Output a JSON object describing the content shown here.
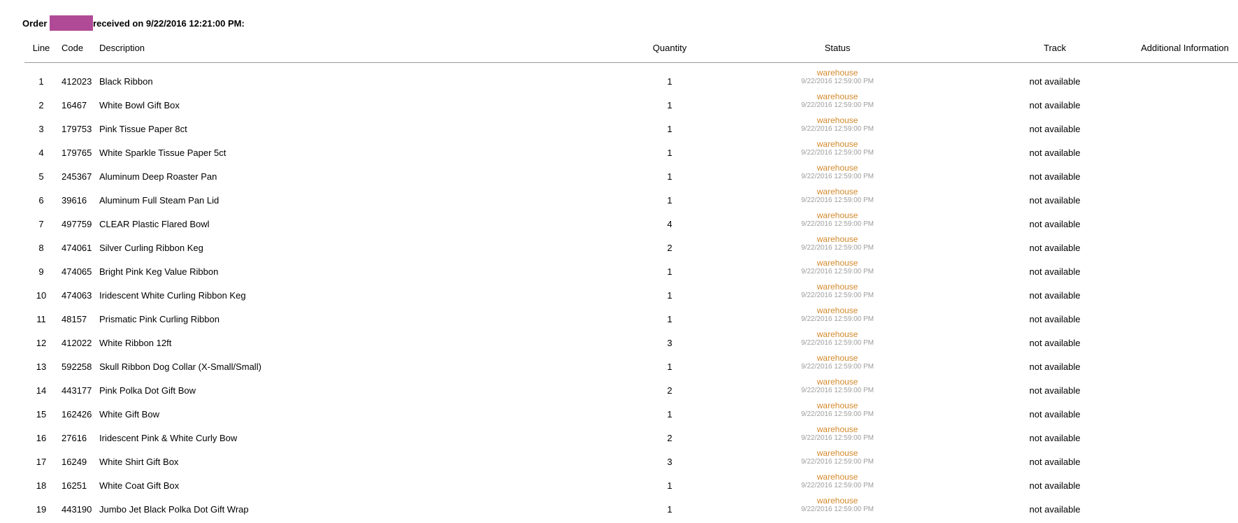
{
  "order": {
    "prefix": "Order",
    "suffix": "received on 9/22/2016 12:21:00 PM:",
    "redaction_color": "#b14a96"
  },
  "columns": {
    "line": "Line",
    "code": "Code",
    "description": "Description",
    "quantity": "Quantity",
    "status": "Status",
    "track": "Track",
    "additional_info": "Additional Information"
  },
  "colors": {
    "status_text": "#d4892b",
    "status_date": "#9d9d9d",
    "divider": "#9a9a9a"
  },
  "rows": [
    {
      "line": "1",
      "code": "412023",
      "description": "Black Ribbon",
      "quantity": "1",
      "status": "warehouse",
      "status_date": "9/22/2016 12:59:00 PM",
      "track": "not available",
      "info": ""
    },
    {
      "line": "2",
      "code": "16467",
      "description": "White Bowl Gift Box",
      "quantity": "1",
      "status": "warehouse",
      "status_date": "9/22/2016 12:59:00 PM",
      "track": "not available",
      "info": ""
    },
    {
      "line": "3",
      "code": "179753",
      "description": "Pink Tissue Paper 8ct",
      "quantity": "1",
      "status": "warehouse",
      "status_date": "9/22/2016 12:59:00 PM",
      "track": "not available",
      "info": ""
    },
    {
      "line": "4",
      "code": "179765",
      "description": "White Sparkle Tissue Paper 5ct",
      "quantity": "1",
      "status": "warehouse",
      "status_date": "9/22/2016 12:59:00 PM",
      "track": "not available",
      "info": ""
    },
    {
      "line": "5",
      "code": "245367",
      "description": "Aluminum Deep Roaster Pan",
      "quantity": "1",
      "status": "warehouse",
      "status_date": "9/22/2016 12:59:00 PM",
      "track": "not available",
      "info": ""
    },
    {
      "line": "6",
      "code": "39616",
      "description": "Aluminum Full Steam Pan Lid",
      "quantity": "1",
      "status": "warehouse",
      "status_date": "9/22/2016 12:59:00 PM",
      "track": "not available",
      "info": ""
    },
    {
      "line": "7",
      "code": "497759",
      "description": "CLEAR Plastic Flared Bowl",
      "quantity": "4",
      "status": "warehouse",
      "status_date": "9/22/2016 12:59:00 PM",
      "track": "not available",
      "info": ""
    },
    {
      "line": "8",
      "code": "474061",
      "description": "Silver Curling Ribbon Keg",
      "quantity": "2",
      "status": "warehouse",
      "status_date": "9/22/2016 12:59:00 PM",
      "track": "not available",
      "info": ""
    },
    {
      "line": "9",
      "code": "474065",
      "description": "Bright Pink Keg Value Ribbon",
      "quantity": "1",
      "status": "warehouse",
      "status_date": "9/22/2016 12:59:00 PM",
      "track": "not available",
      "info": ""
    },
    {
      "line": "10",
      "code": "474063",
      "description": "Iridescent White Curling Ribbon Keg",
      "quantity": "1",
      "status": "warehouse",
      "status_date": "9/22/2016 12:59:00 PM",
      "track": "not available",
      "info": ""
    },
    {
      "line": "11",
      "code": "48157",
      "description": "Prismatic Pink Curling Ribbon",
      "quantity": "1",
      "status": "warehouse",
      "status_date": "9/22/2016 12:59:00 PM",
      "track": "not available",
      "info": ""
    },
    {
      "line": "12",
      "code": "412022",
      "description": "White Ribbon 12ft",
      "quantity": "3",
      "status": "warehouse",
      "status_date": "9/22/2016 12:59:00 PM",
      "track": "not available",
      "info": ""
    },
    {
      "line": "13",
      "code": "592258",
      "description": "Skull Ribbon Dog Collar (X-Small/Small)",
      "quantity": "1",
      "status": "warehouse",
      "status_date": "9/22/2016 12:59:00 PM",
      "track": "not available",
      "info": ""
    },
    {
      "line": "14",
      "code": "443177",
      "description": "Pink Polka Dot Gift Bow",
      "quantity": "2",
      "status": "warehouse",
      "status_date": "9/22/2016 12:59:00 PM",
      "track": "not available",
      "info": ""
    },
    {
      "line": "15",
      "code": "162426",
      "description": "White Gift Bow",
      "quantity": "1",
      "status": "warehouse",
      "status_date": "9/22/2016 12:59:00 PM",
      "track": "not available",
      "info": ""
    },
    {
      "line": "16",
      "code": "27616",
      "description": "Iridescent Pink & White Curly Bow",
      "quantity": "2",
      "status": "warehouse",
      "status_date": "9/22/2016 12:59:00 PM",
      "track": "not available",
      "info": ""
    },
    {
      "line": "17",
      "code": "16249",
      "description": "White Shirt Gift Box",
      "quantity": "3",
      "status": "warehouse",
      "status_date": "9/22/2016 12:59:00 PM",
      "track": "not available",
      "info": ""
    },
    {
      "line": "18",
      "code": "16251",
      "description": "White Coat Gift Box",
      "quantity": "1",
      "status": "warehouse",
      "status_date": "9/22/2016 12:59:00 PM",
      "track": "not available",
      "info": ""
    },
    {
      "line": "19",
      "code": "443190",
      "description": "Jumbo Jet Black Polka Dot Gift Wrap",
      "quantity": "1",
      "status": "warehouse",
      "status_date": "9/22/2016 12:59:00 PM",
      "track": "not available",
      "info": ""
    }
  ]
}
